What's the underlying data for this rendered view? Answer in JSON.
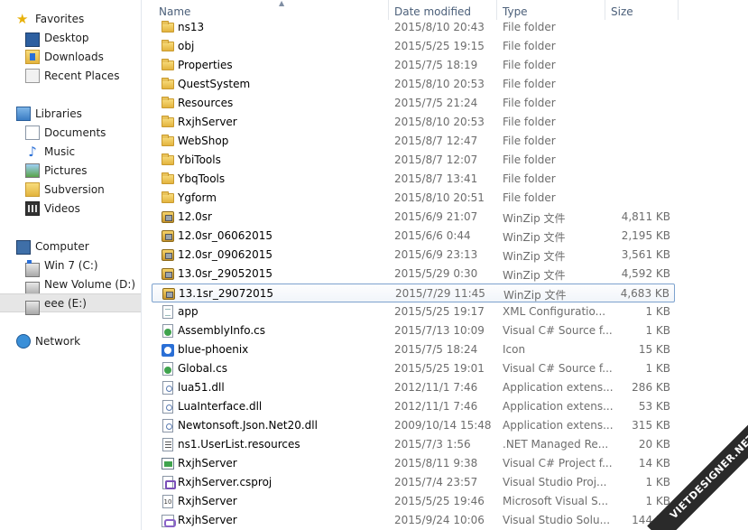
{
  "nav": {
    "favorites": {
      "label": "Favorites",
      "icon": "star-icon"
    },
    "favorite_items": [
      {
        "label": "Desktop",
        "icon": "desktop-icon"
      },
      {
        "label": "Downloads",
        "icon": "downloads-folder-icon"
      },
      {
        "label": "Recent Places",
        "icon": "recent-places-icon"
      }
    ],
    "libraries": {
      "label": "Libraries",
      "icon": "libraries-icon"
    },
    "library_items": [
      {
        "label": "Documents",
        "icon": "documents-icon"
      },
      {
        "label": "Music",
        "icon": "music-icon"
      },
      {
        "label": "Pictures",
        "icon": "pictures-icon"
      },
      {
        "label": "Subversion",
        "icon": "subversion-icon"
      },
      {
        "label": "Videos",
        "icon": "videos-icon"
      }
    ],
    "computer": {
      "label": "Computer",
      "icon": "computer-icon"
    },
    "drives": [
      {
        "label": "Win 7 (C:)",
        "icon": "system-drive-icon"
      },
      {
        "label": "New Volume (D:)",
        "icon": "drive-icon"
      },
      {
        "label": "eee (E:)",
        "icon": "drive-icon",
        "selected": true
      }
    ],
    "network": {
      "label": "Network",
      "icon": "network-icon"
    }
  },
  "columns": {
    "name": "Name",
    "date_modified": "Date modified",
    "type": "Type",
    "size": "Size"
  },
  "files": [
    {
      "name": "ns13",
      "date": "2015/8/10 20:43",
      "type": "File folder",
      "size": "",
      "icon": "folder"
    },
    {
      "name": "obj",
      "date": "2015/5/25 19:15",
      "type": "File folder",
      "size": "",
      "icon": "folder"
    },
    {
      "name": "Properties",
      "date": "2015/7/5 18:19",
      "type": "File folder",
      "size": "",
      "icon": "folder"
    },
    {
      "name": "QuestSystem",
      "date": "2015/8/10 20:53",
      "type": "File folder",
      "size": "",
      "icon": "folder"
    },
    {
      "name": "Resources",
      "date": "2015/7/5 21:24",
      "type": "File folder",
      "size": "",
      "icon": "folder"
    },
    {
      "name": "RxjhServer",
      "date": "2015/8/10 20:53",
      "type": "File folder",
      "size": "",
      "icon": "folder"
    },
    {
      "name": "WebShop",
      "date": "2015/8/7 12:47",
      "type": "File folder",
      "size": "",
      "icon": "folder"
    },
    {
      "name": "YbiTools",
      "date": "2015/8/7 12:07",
      "type": "File folder",
      "size": "",
      "icon": "folder"
    },
    {
      "name": "YbqTools",
      "date": "2015/8/7 13:41",
      "type": "File folder",
      "size": "",
      "icon": "folder"
    },
    {
      "name": "Ygform",
      "date": "2015/8/10 20:51",
      "type": "File folder",
      "size": "",
      "icon": "folder"
    },
    {
      "name": "12.0sr",
      "date": "2015/6/9 21:07",
      "type": "WinZip 文件",
      "size": "4,811 KB",
      "icon": "zip"
    },
    {
      "name": "12.0sr_06062015",
      "date": "2015/6/6 0:44",
      "type": "WinZip 文件",
      "size": "2,195 KB",
      "icon": "zip"
    },
    {
      "name": "12.0sr_09062015",
      "date": "2015/6/9 23:13",
      "type": "WinZip 文件",
      "size": "3,561 KB",
      "icon": "zip"
    },
    {
      "name": "13.0sr_29052015",
      "date": "2015/5/29 0:30",
      "type": "WinZip 文件",
      "size": "4,592 KB",
      "icon": "zip"
    },
    {
      "name": "13.1sr_29072015",
      "date": "2015/7/29 11:45",
      "type": "WinZip 文件",
      "size": "4,683 KB",
      "icon": "zip",
      "selected": true
    },
    {
      "name": "app",
      "date": "2015/5/25 19:17",
      "type": "XML Configuratio...",
      "size": "1 KB",
      "icon": "doc"
    },
    {
      "name": "AssemblyInfo.cs",
      "date": "2015/7/13 10:09",
      "type": "Visual C# Source f...",
      "size": "1 KB",
      "icon": "cs"
    },
    {
      "name": "blue-phoenix",
      "date": "2015/7/5 18:24",
      "type": "Icon",
      "size": "15 KB",
      "icon": "ico"
    },
    {
      "name": "Global.cs",
      "date": "2015/5/25 19:01",
      "type": "Visual C# Source f...",
      "size": "1 KB",
      "icon": "cs"
    },
    {
      "name": "lua51.dll",
      "date": "2012/11/1 7:46",
      "type": "Application extens...",
      "size": "286 KB",
      "icon": "dll"
    },
    {
      "name": "LuaInterface.dll",
      "date": "2012/11/1 7:46",
      "type": "Application extens...",
      "size": "53 KB",
      "icon": "dll"
    },
    {
      "name": "Newtonsoft.Json.Net20.dll",
      "date": "2009/10/14 15:48",
      "type": "Application extens...",
      "size": "315 KB",
      "icon": "dll"
    },
    {
      "name": "ns1.UserList.resources",
      "date": "2015/7/3 1:56",
      "type": ".NET Managed Re...",
      "size": "20 KB",
      "icon": "res"
    },
    {
      "name": "RxjhServer",
      "date": "2015/8/11 9:38",
      "type": "Visual C# Project f...",
      "size": "14 KB",
      "icon": "proj"
    },
    {
      "name": "RxjhServer.csproj",
      "date": "2015/7/4 23:57",
      "type": "Visual Studio Proj...",
      "size": "1 KB",
      "icon": "vs"
    },
    {
      "name": "RxjhServer",
      "date": "2015/5/25 19:46",
      "type": "Microsoft Visual S...",
      "size": "1 KB",
      "icon": "vs10"
    },
    {
      "name": "RxjhServer",
      "date": "2015/9/24 10:06",
      "type": "Visual Studio Solu...",
      "size": "144 KB",
      "icon": "sln"
    }
  ],
  "watermark": "VIETDESIGNER.NET"
}
